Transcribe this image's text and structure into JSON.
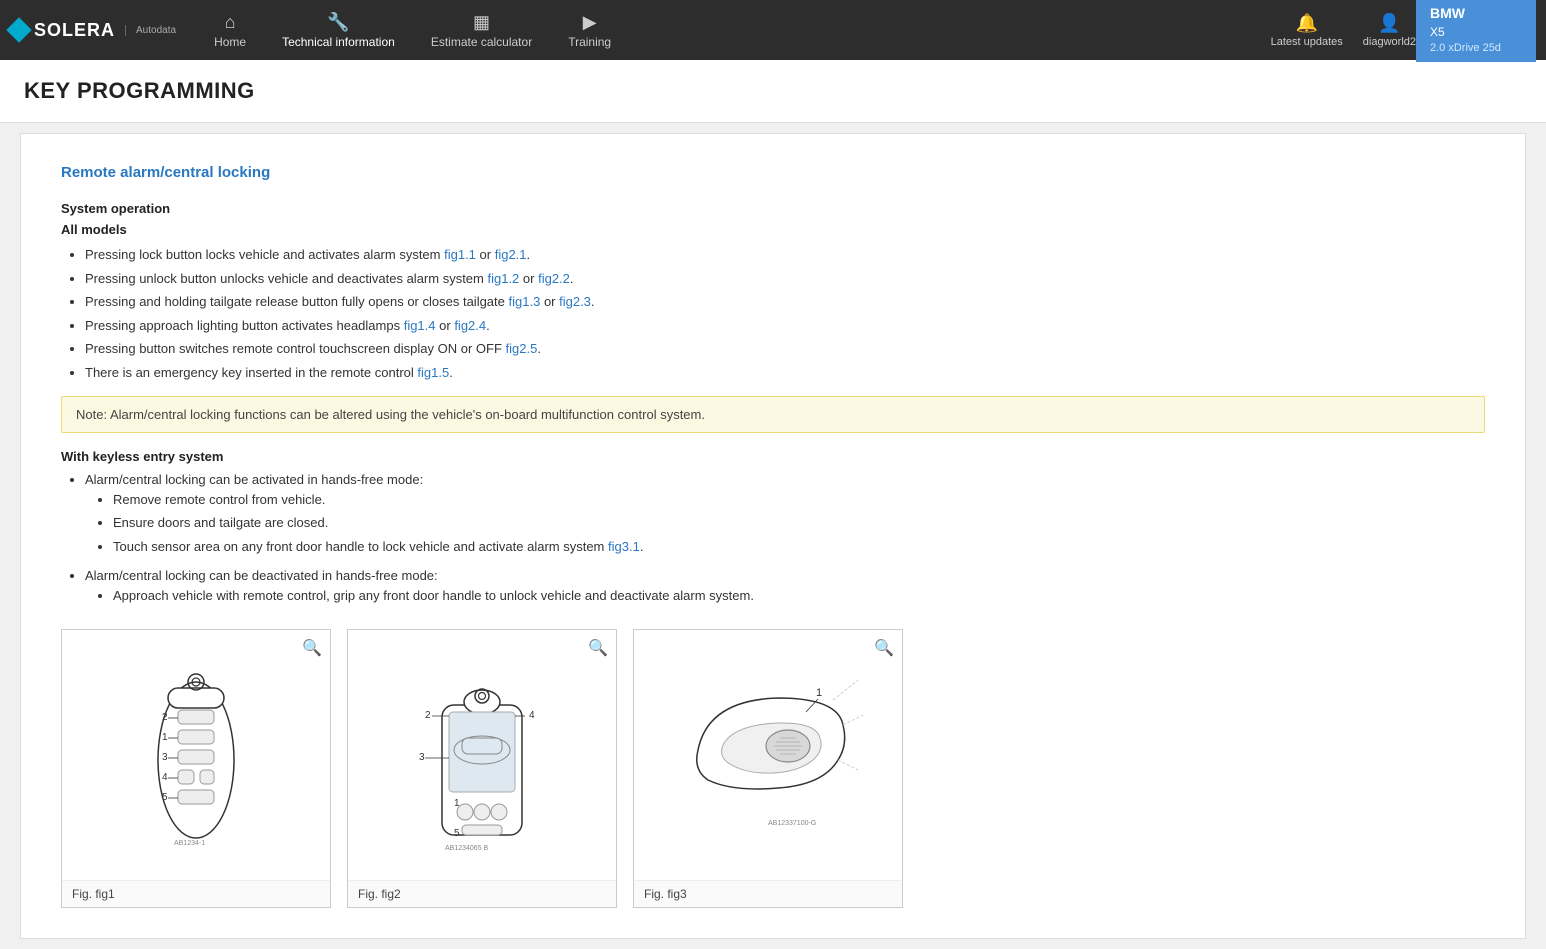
{
  "brand": "SOLERA",
  "brand_sub": "Autodata",
  "nav": {
    "items": [
      {
        "id": "home",
        "label": "Home",
        "icon": "⌂",
        "active": false
      },
      {
        "id": "technical",
        "label": "Technical information",
        "icon": "🔧",
        "active": true
      },
      {
        "id": "estimate",
        "label": "Estimate calculator",
        "icon": "▦",
        "active": false
      },
      {
        "id": "training",
        "label": "Training",
        "icon": "▶",
        "active": false
      }
    ],
    "right": [
      {
        "id": "updates",
        "label": "Latest updates",
        "icon": "🔔"
      },
      {
        "id": "user",
        "label": "diagworld2",
        "icon": "👤"
      }
    ]
  },
  "vehicle": {
    "brand": "BMW",
    "model": "X5",
    "variant": "2.0 xDrive 25d"
  },
  "page_title": "KEY PROGRAMMING",
  "content": {
    "section_title": "Remote alarm/central locking",
    "system_operation": "System operation",
    "all_models": "All models",
    "bullets": [
      {
        "text": "Pressing lock button locks vehicle and activates alarm system ",
        "links": [
          {
            "label": "fig1.1",
            "href": "#"
          },
          {
            "sep": " or "
          },
          {
            "label": "fig2.1",
            "href": "#"
          }
        ],
        "end": "."
      },
      {
        "text": "Pressing unlock button unlocks vehicle and deactivates alarm system ",
        "links": [
          {
            "label": "fig1.2",
            "href": "#"
          },
          {
            "sep": " or "
          },
          {
            "label": "fig2.2",
            "href": "#"
          }
        ],
        "end": "."
      },
      {
        "text": "Pressing and holding tailgate release button fully opens or closes tailgate ",
        "links": [
          {
            "label": "fig1.3",
            "href": "#"
          },
          {
            "sep": " or "
          },
          {
            "label": "fig2.3",
            "href": "#"
          }
        ],
        "end": "."
      },
      {
        "text": "Pressing approach lighting button activates headlamps ",
        "links": [
          {
            "label": "fig1.4",
            "href": "#"
          },
          {
            "sep": " or "
          },
          {
            "label": "fig2.4",
            "href": "#"
          }
        ],
        "end": "."
      },
      {
        "text": "Pressing button switches remote control touchscreen display ON or OFF ",
        "links": [
          {
            "label": "fig2.5",
            "href": "#"
          }
        ],
        "end": "."
      },
      {
        "text": "There is an emergency key inserted in the remote control ",
        "links": [
          {
            "label": "fig1.5",
            "href": "#"
          }
        ],
        "end": "."
      }
    ],
    "note": "Note: Alarm/central locking functions can be altered using the vehicle's on-board multifunction control system.",
    "keyless_title": "With keyless entry system",
    "keyless_bullets": [
      {
        "text": "Alarm/central locking can be activated in hands-free mode:",
        "sub": [
          "Remove remote control from vehicle.",
          "Ensure doors and tailgate are closed.",
          {
            "text": "Touch sensor area on any front door handle to lock vehicle and activate alarm system ",
            "links": [
              {
                "label": "fig3.1",
                "href": "#"
              }
            ],
            "end": "."
          }
        ]
      },
      {
        "text": "Alarm/central locking can be deactivated in hands-free mode:",
        "sub": [
          "Approach vehicle with remote control, grip any front door handle to unlock vehicle and deactivate alarm system."
        ]
      }
    ],
    "figures": [
      {
        "id": "fig1",
        "caption": "Fig. fig1"
      },
      {
        "id": "fig2",
        "caption": "Fig. fig2"
      },
      {
        "id": "fig3",
        "caption": "Fig. fig3"
      }
    ]
  }
}
